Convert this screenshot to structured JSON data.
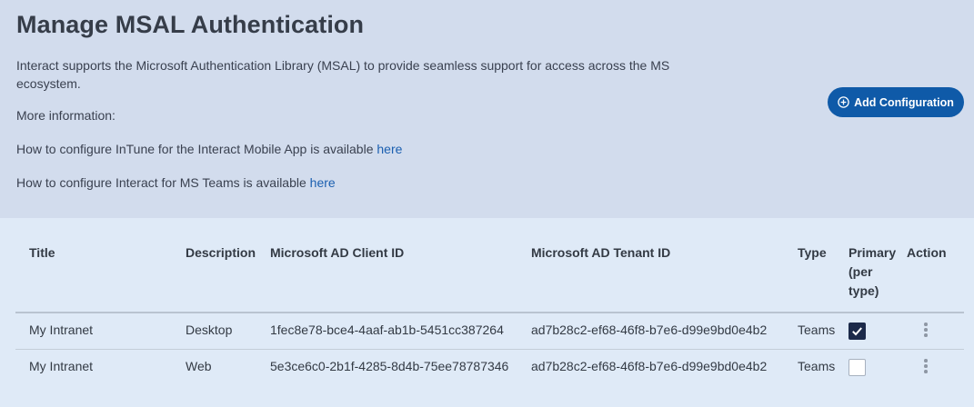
{
  "page": {
    "title": "Manage MSAL Authentication",
    "intro": "Interact supports the Microsoft Authentication Library (MSAL) to provide seamless support for access across the MS ecosystem.",
    "more_info": "More information:",
    "intune_text": "How to configure InTune for the Interact Mobile App is available ",
    "intune_link": "here",
    "teams_text": "How to configure Interact for MS Teams is available ",
    "teams_link": "here"
  },
  "toolbar": {
    "add_label": "Add Configuration",
    "add_icon": "plus-circle-icon"
  },
  "table": {
    "headers": {
      "title": "Title",
      "description": "Description",
      "client_id": "Microsoft AD Client ID",
      "tenant_id": "Microsoft AD Tenant ID",
      "type": "Type",
      "primary_1": "Primary",
      "primary_2": "(per",
      "primary_3": "type)",
      "action": "Action"
    },
    "rows": [
      {
        "title": "My Intranet",
        "description": "Desktop",
        "client_id": "1fec8e78-bce4-4aaf-ab1b-5451cc387264",
        "tenant_id": "ad7b28c2-ef68-46f8-b7e6-d99e9bd0e4b2",
        "type": "Teams",
        "primary": true,
        "action_icon": "more-vertical-icon"
      },
      {
        "title": "My Intranet",
        "description": "Web",
        "client_id": "5e3ce6c0-2b1f-4285-8d4b-75ee78787346",
        "tenant_id": "ad7b28c2-ef68-46f8-b7e6-d99e9bd0e4b2",
        "type": "Teams",
        "primary": false,
        "action_icon": "more-vertical-icon"
      }
    ]
  },
  "colors": {
    "header_bg": "#d2dced",
    "body_bg": "#dfeaf7",
    "accent": "#0f5aa8",
    "link": "#1b5fb0",
    "checkbox_checked": "#1c2a4a"
  }
}
